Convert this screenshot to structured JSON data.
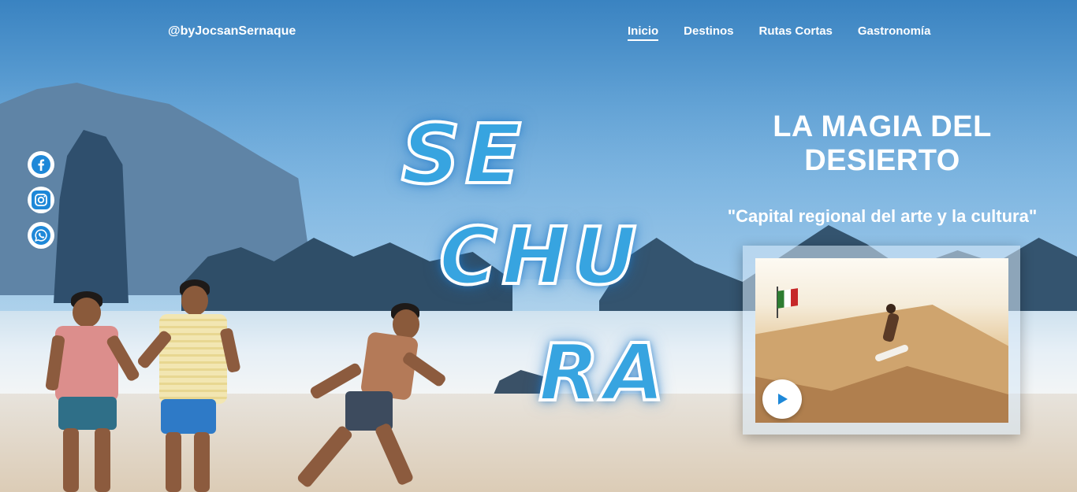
{
  "header": {
    "brand": "@byJocsanSernaque",
    "nav": [
      {
        "label": "Inicio",
        "active": true
      },
      {
        "label": "Destinos",
        "active": false
      },
      {
        "label": "Rutas Cortas",
        "active": false
      },
      {
        "label": "Gastronomía",
        "active": false
      }
    ]
  },
  "social": [
    {
      "icon": "facebook-icon"
    },
    {
      "icon": "instagram-icon"
    },
    {
      "icon": "whatsapp-icon"
    }
  ],
  "hero": {
    "title_lines": [
      "SE",
      "CHU",
      "RA"
    ],
    "heading": "LA MAGIA DEL DESIERTO",
    "subheading": "\"Capital regional del arte y la cultura\""
  },
  "video": {
    "play_icon": "play-icon"
  },
  "colors": {
    "accent_blue": "#37a4e0",
    "social_icon_blue": "#1e88d8",
    "text": "#ffffff"
  }
}
